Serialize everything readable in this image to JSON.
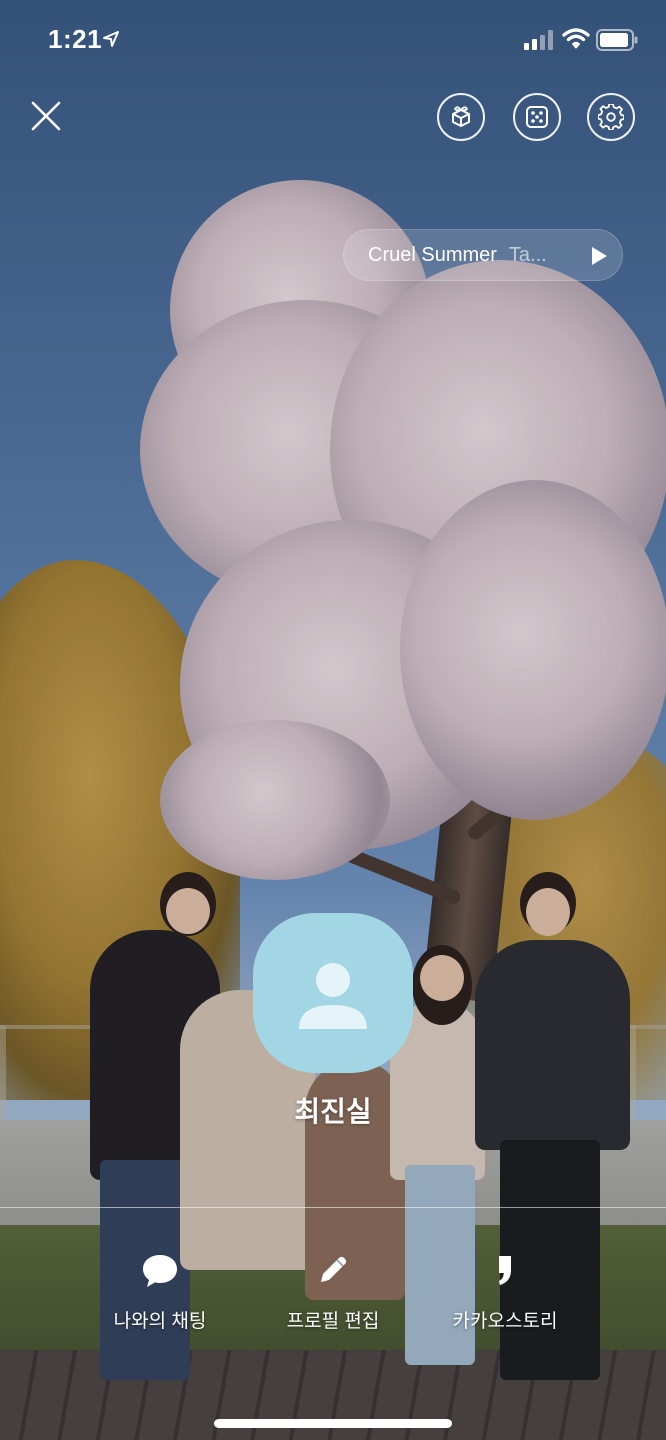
{
  "status_bar": {
    "time": "1:21",
    "icons": [
      "location-arrow-icon",
      "cellular-signal-icon",
      "wifi-icon",
      "battery-icon"
    ]
  },
  "top_bar": {
    "close_icon": "close-icon",
    "buttons": [
      {
        "name": "gift-box-icon"
      },
      {
        "name": "dice-icon"
      },
      {
        "name": "settings-gear-icon"
      }
    ]
  },
  "music": {
    "title": "Cruel Summer",
    "artist": "Ta...",
    "play_icon": "play-icon"
  },
  "profile": {
    "name": "최진실",
    "avatar_color": "#a3d6e5"
  },
  "actions": [
    {
      "label": "나와의 채팅",
      "icon": "chat-bubble-icon"
    },
    {
      "label": "프로필 편집",
      "icon": "pencil-icon"
    },
    {
      "label": "카카오스토리",
      "icon": "kakaostory-icon"
    }
  ],
  "colors": {
    "foreground": "#ffffff",
    "avatar": "#a3d6e5"
  }
}
